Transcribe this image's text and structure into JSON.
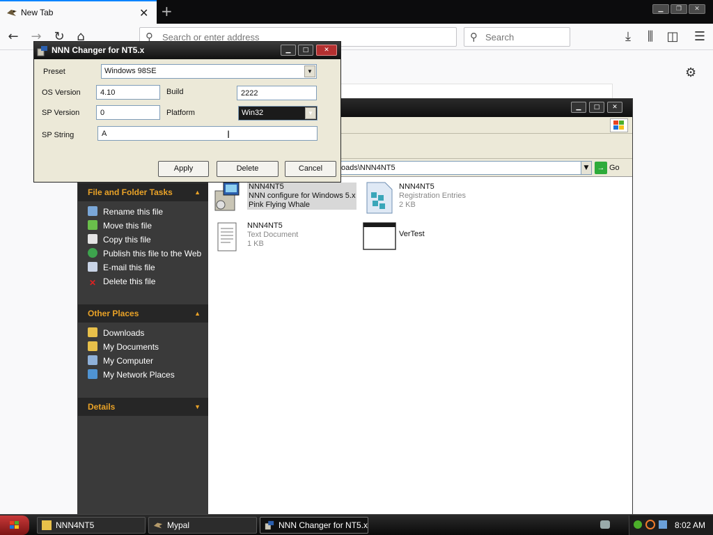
{
  "browser": {
    "tab_title": "New Tab",
    "url_placeholder": "Search or enter address",
    "search_placeholder": "Search"
  },
  "explorer": {
    "address_text": "oads\\NNN4NT5",
    "go_label": "Go",
    "task_groups": [
      {
        "title": "File and Folder Tasks",
        "items": [
          "Rename this file",
          "Move this file",
          "Copy this file",
          "Publish this file to the Web",
          "E-mail this file",
          "Delete this file"
        ]
      },
      {
        "title": "Other Places",
        "items": [
          "Downloads",
          "My Documents",
          "My Computer",
          "My Network Places"
        ]
      },
      {
        "title": "Details",
        "items": []
      }
    ],
    "files": [
      {
        "name": "NNN4NT5",
        "line2": "NNN configure for Windows 5.x",
        "line3": "Pink Flying Whale",
        "icon": "installer-icon"
      },
      {
        "name": "NNN4NT5",
        "line2": "Registration Entries",
        "line3": "2 KB",
        "icon": "registry-file-icon"
      },
      {
        "name": "NNN4NT5",
        "line2": "Text Document",
        "line3": "1 KB",
        "icon": "text-document-icon"
      },
      {
        "name": "VerTest",
        "line2": "",
        "line3": "",
        "icon": "application-window-icon"
      }
    ]
  },
  "dialog": {
    "title": "NNN Changer for NT5.x",
    "preset_label": "Preset",
    "preset_value": "Windows 98SE",
    "os_version_label": "OS Version",
    "os_version_value": "4.10",
    "build_label": "Build",
    "build_value": "2222",
    "sp_version_label": "SP Version",
    "sp_version_value": "0",
    "platform_label": "Platform",
    "platform_value": "Win32",
    "sp_string_label": "SP String",
    "sp_string_value": "A",
    "apply_label": "Apply",
    "delete_label": "Delete",
    "cancel_label": "Cancel"
  },
  "taskbar": {
    "buttons": [
      "NNN4NT5",
      "Mypal",
      "NNN Changer for NT5.x"
    ],
    "clock": "8:02 AM"
  },
  "colors": {
    "task_header": "#e9a227",
    "browser_accent": "#0a84ff",
    "start_button": "#c83939"
  }
}
